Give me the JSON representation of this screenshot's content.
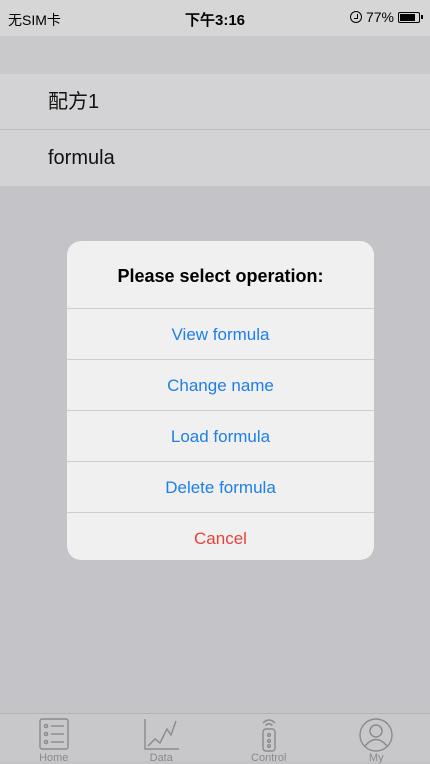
{
  "status_bar": {
    "carrier": "无SIM卡",
    "time": "下午3:16",
    "battery": "77%"
  },
  "list": {
    "items": [
      {
        "label": "配方1"
      },
      {
        "label": "formula"
      }
    ]
  },
  "alert": {
    "title": "Please select operation:",
    "actions": [
      {
        "label": "View formula"
      },
      {
        "label": "Change name"
      },
      {
        "label": "Load formula"
      },
      {
        "label": "Delete formula"
      }
    ],
    "cancel_label": "Cancel",
    "action_color": "#1f7ee8",
    "cancel_color": "#e5423a"
  },
  "tab_bar": {
    "tabs": [
      {
        "label": "Home",
        "icon": "list-icon"
      },
      {
        "label": "Data",
        "icon": "chart-icon"
      },
      {
        "label": "Control",
        "icon": "remote-icon"
      },
      {
        "label": "My",
        "icon": "user-icon"
      }
    ]
  }
}
